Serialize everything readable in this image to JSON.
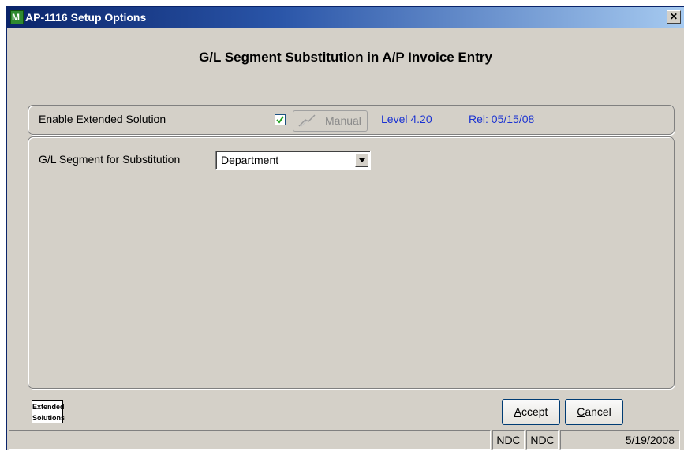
{
  "window": {
    "title": "AP-1116 Setup Options",
    "icon": "app-icon",
    "close_glyph": "✕"
  },
  "heading": "G/L Segment Substitution in A/P Invoice Entry",
  "options": {
    "enable_label": "Enable Extended Solution",
    "enable_checked": true,
    "manual_label": "Manual",
    "level": "Level 4.20",
    "release": "Rel: 05/15/08"
  },
  "segment": {
    "label": "G/L Segment for Substitution",
    "selected": "Department"
  },
  "logo": {
    "line1": "Extended",
    "line2": "Solutions"
  },
  "buttons": {
    "accept": {
      "mnemonic": "A",
      "rest": "ccept"
    },
    "cancel": {
      "mnemonic": "C",
      "rest": "ancel"
    }
  },
  "statusbar": {
    "cell1": "",
    "cell2": "NDC",
    "cell3": "NDC",
    "date": "5/19/2008"
  },
  "colors": {
    "title_bar": "#0a246a",
    "dialog_bg": "#d4d0c8",
    "info_text": "#1a32d2"
  }
}
